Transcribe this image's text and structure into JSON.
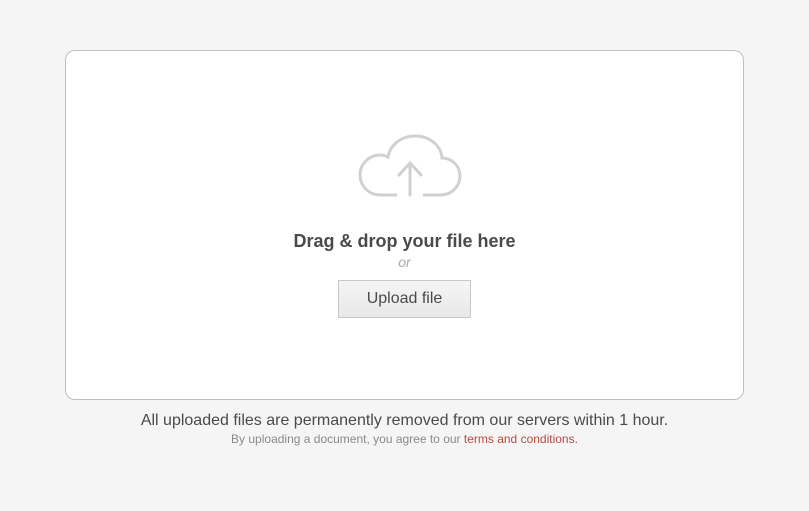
{
  "dropzone": {
    "heading": "Drag & drop your file here",
    "or": "or",
    "button": "Upload file"
  },
  "footer": {
    "notice": "All uploaded files are permanently removed from our servers within 1 hour.",
    "agreement_prefix": "By uploading a document, you agree to our ",
    "terms_link": "terms and conditions",
    "agreement_suffix": "."
  }
}
